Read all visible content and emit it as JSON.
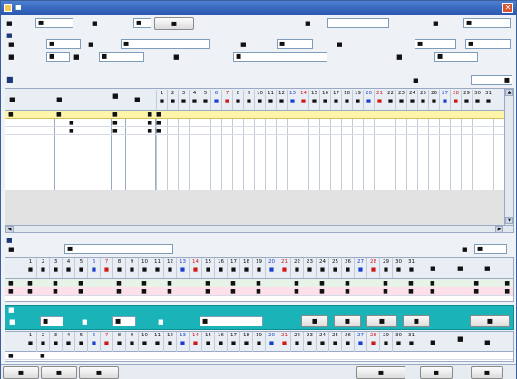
{
  "window": {
    "title": "■",
    "close_icon": "close-icon"
  },
  "header": {
    "date_label": "■",
    "date_value": "■",
    "office_label": "■",
    "office_value": "■",
    "office_list_button": "■",
    "creator_label": "■",
    "creator_value": "",
    "created_date_label": "■",
    "created_date_value": "■"
  },
  "insured": {
    "section_title": "■",
    "number_label": "■",
    "number_value": "■",
    "name_label": "■",
    "name_value": "■",
    "care_level_label": "■",
    "care_level_value": "■",
    "valid_period_label": "■",
    "valid_from": "■",
    "valid_to": "■",
    "insurer_number_label": "■",
    "insurer_number_value": "■",
    "insurer_name_label": "■",
    "insurer_name_value": "■",
    "provider_label": "■",
    "provider_value": "■",
    "care_manager_label": "■",
    "care_manager_value": "■"
  },
  "service_list": {
    "section_title": "■",
    "total_label": "■",
    "total_value": "■",
    "columns": {
      "time": "■",
      "content": "■",
      "count": "■",
      "unit": "■"
    },
    "rows": [
      {
        "time": "■",
        "content": "■",
        "count": "■",
        "unit": "■",
        "mark": "■"
      },
      {
        "time": "",
        "content": "■",
        "count": "■",
        "unit": "■",
        "mark": "■"
      },
      {
        "time": "",
        "content": "■",
        "count": "■",
        "unit": "■",
        "mark": "■"
      }
    ]
  },
  "calendar": {
    "days": [
      "1",
      "2",
      "3",
      "4",
      "5",
      "6",
      "7",
      "8",
      "9",
      "10",
      "11",
      "12",
      "13",
      "14",
      "15",
      "16",
      "17",
      "18",
      "19",
      "20",
      "21",
      "22",
      "23",
      "24",
      "25",
      "26",
      "27",
      "28",
      "29",
      "30",
      "31"
    ],
    "weekdays": [
      "■",
      "■",
      "■",
      "■",
      "■",
      "■",
      "■",
      "■",
      "■",
      "■",
      "■",
      "■",
      "■",
      "■",
      "■",
      "■",
      "■",
      "■",
      "■",
      "■",
      "■",
      "■",
      "■",
      "■",
      "■",
      "■",
      "■",
      "■",
      "■",
      "■",
      "■"
    ]
  },
  "weekly": {
    "section_title": "■",
    "content_label": "■",
    "content_value": "■",
    "unit_label": "■",
    "unit_value": "■",
    "summary_headers": [
      "■",
      "■",
      "■"
    ],
    "rows": [
      {
        "label": "■",
        "values": [
          "■",
          "■",
          "■",
          "■",
          "■",
          "■",
          "■",
          "■",
          "■",
          "■",
          "■",
          "■",
          "■",
          "■"
        ],
        "summary": [
          "■",
          "■",
          "■"
        ]
      },
      {
        "label": "■",
        "values": [
          "■",
          "■",
          "■",
          "■",
          "■",
          "■",
          "■",
          "■",
          "■",
          "■",
          "■",
          "■",
          "■",
          "■"
        ],
        "summary": [
          "■",
          "■",
          "■"
        ]
      }
    ]
  },
  "service_input": {
    "section_title": "■",
    "start_label": "■",
    "start_value": "■",
    "end_label": "■",
    "end_value": "■",
    "content_label": "■",
    "content_value": "■",
    "buttons": [
      "■",
      "■",
      "■",
      "■"
    ],
    "status_button": "■",
    "row_label": "■",
    "row_value": "■",
    "summary_headers": [
      "■",
      "■",
      "■"
    ]
  },
  "footer": {
    "left_buttons": [
      "■",
      "■",
      "■"
    ],
    "right_buttons": [
      "■",
      "■",
      "■"
    ]
  },
  "colors": {
    "title_bar": "#2a57b0",
    "teal_panel": "#19b3b8",
    "selected_row": "#fff9c4",
    "plan_row": "#e8f3e8",
    "actual_row": "#fde0ea",
    "saturday": "#1a3fd0",
    "sunday": "#d01818"
  }
}
